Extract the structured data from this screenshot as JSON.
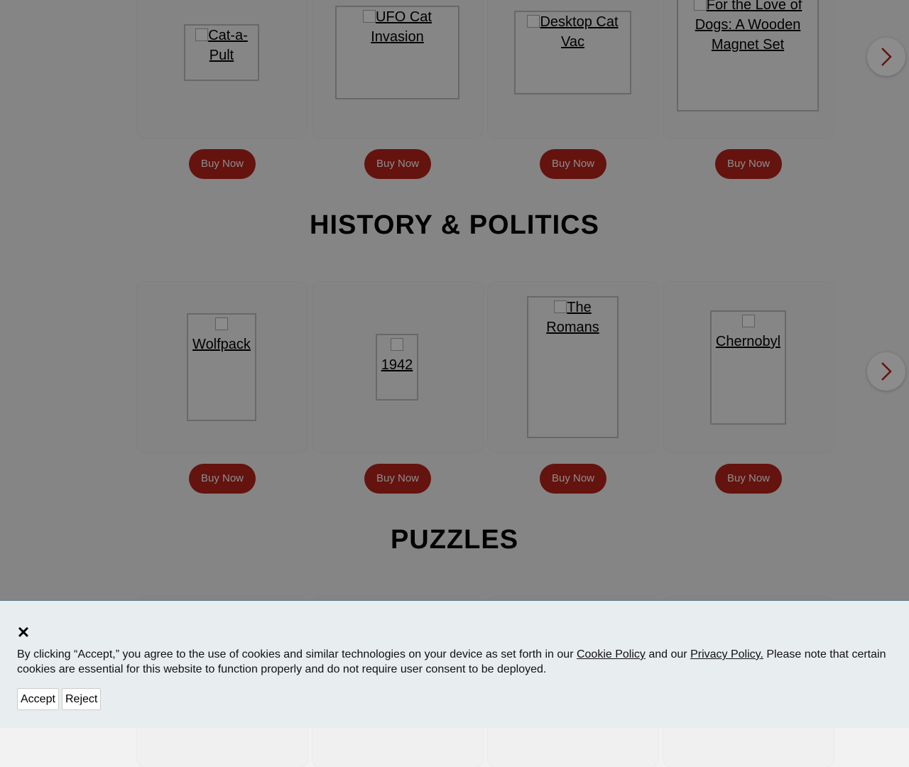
{
  "sections": [
    {
      "title": "",
      "products": [
        {
          "name": "Cat-a-Pult",
          "button": "Buy Now"
        },
        {
          "name": "UFO Cat Invasion",
          "button": "Buy Now"
        },
        {
          "name": "Desktop Cat Vac",
          "button": "Buy Now"
        },
        {
          "name": "For the Love of Dogs: A Wooden Magnet Set",
          "button": "Buy Now"
        }
      ]
    },
    {
      "title": "HISTORY & POLITICS",
      "products": [
        {
          "name": "Wolfpack",
          "button": "Buy Now"
        },
        {
          "name": "1942",
          "button": "Buy Now"
        },
        {
          "name": "The Romans",
          "button": "Buy Now"
        },
        {
          "name": "Chernobyl",
          "button": "Buy Now"
        }
      ]
    },
    {
      "title": "PUZZLES",
      "products": []
    }
  ],
  "carousel": {
    "next_icon": "chevron-right-icon"
  },
  "cookie": {
    "close_symbol": "✕",
    "text_before": "By clicking “Accept,” you agree to the use of cookies and similar technologies on your device as set forth in our ",
    "cookie_policy_link": "Cookie Policy",
    "text_middle": " and our ",
    "privacy_policy_link": "Privacy Policy.",
    "text_after": " Please note that certain cookies are essential for this website to function properly and do not require user consent to be deployed.",
    "accept_label": "Accept",
    "reject_label": "Reject"
  },
  "colors": {
    "buy_button": "#b7231b",
    "banner_bg": "#e8edf0",
    "overlay": "rgba(0,0,0,0.45)"
  }
}
